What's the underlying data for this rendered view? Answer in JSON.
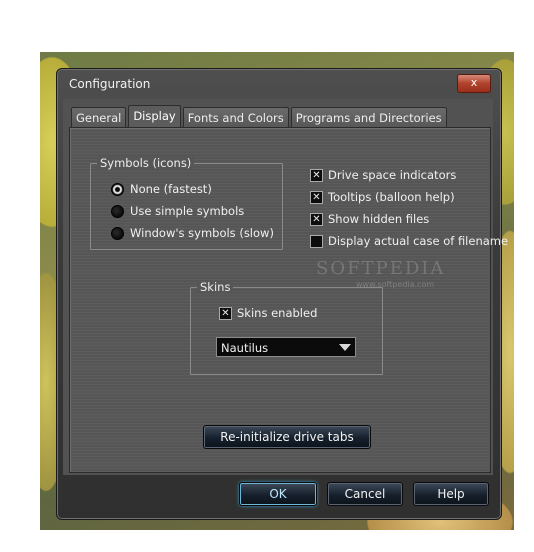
{
  "window": {
    "title": "Configuration",
    "close_label": "x"
  },
  "tabs": [
    {
      "label": "General",
      "active": false
    },
    {
      "label": "Display",
      "active": true
    },
    {
      "label": "Fonts and Colors",
      "active": false
    },
    {
      "label": "Programs and Directories",
      "active": false
    }
  ],
  "symbols": {
    "title": "Symbols (icons)",
    "options": [
      {
        "label": "None (fastest)",
        "selected": true
      },
      {
        "label": "Use simple symbols",
        "selected": false
      },
      {
        "label": "Window's symbols (slow)",
        "selected": false
      }
    ]
  },
  "options": [
    {
      "label": "Drive space indicators",
      "checked": true
    },
    {
      "label": "Tooltips (balloon help)",
      "checked": true
    },
    {
      "label": "Show hidden files",
      "checked": true
    },
    {
      "label": "Display actual case of filename",
      "checked": false
    }
  ],
  "skins": {
    "title": "Skins",
    "enabled_label": "Skins enabled",
    "enabled": true,
    "selected_skin": "Nautilus"
  },
  "reinit_label": "Re-initialize drive tabs",
  "footer": {
    "ok_label": "OK",
    "cancel_label": "Cancel",
    "help_label": "Help"
  },
  "watermark": {
    "text": "SOFTPEDIA",
    "url": "www.softpedia.com"
  }
}
